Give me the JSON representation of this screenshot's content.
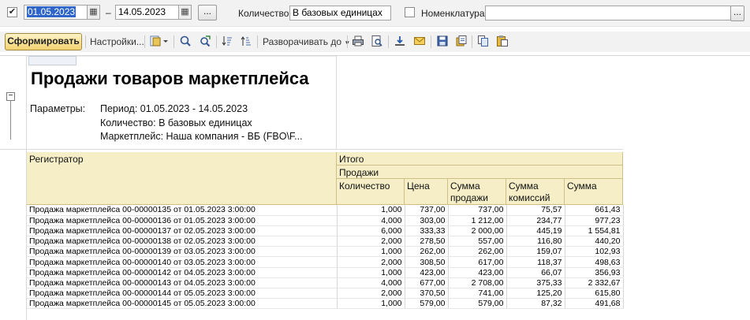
{
  "filter": {
    "period_checked": "✔",
    "date_from": "01.05.2023",
    "dash": "–",
    "date_to": "14.05.2023",
    "period_more": "...",
    "quantity_label": "Количество:",
    "quantity_value": "В базовых единицах",
    "nomenclature_label": "Номенклатура:",
    "nomenclature_value": "",
    "nomenclature_more": "..."
  },
  "toolbar": {
    "generate": "Сформировать",
    "settings": "Настройки...",
    "expand_to": "Разворачивать до"
  },
  "report": {
    "title": "Продажи товаров маркетплейса",
    "params_label": "Параметры:",
    "params": [
      "Период: 01.05.2023 - 14.05.2023",
      "Количество: В базовых единицах",
      "Маркетплейс: Наша компания - ВБ (FBO\\F..."
    ],
    "headers": {
      "registrar": "Регистратор",
      "total": "Итого",
      "sales": "Продажи",
      "quantity": "Количество",
      "price": "Цена",
      "sale_sum_1": "Сумма",
      "sale_sum_2": "продажи",
      "commission_1": "Сумма",
      "commission_2": "комиссий",
      "sum": "Сумма"
    },
    "rows": [
      {
        "doc": "Продажа маркетплейса 00-00000135 от 01.05.2023 3:00:00",
        "qty": "1,000",
        "price": "737,00",
        "sale": "737,00",
        "comm": "75,57",
        "sum": "661,43"
      },
      {
        "doc": "Продажа маркетплейса 00-00000136 от 01.05.2023 3:00:00",
        "qty": "4,000",
        "price": "303,00",
        "sale": "1 212,00",
        "comm": "234,77",
        "sum": "977,23"
      },
      {
        "doc": "Продажа маркетплейса 00-00000137 от 02.05.2023 3:00:00",
        "qty": "6,000",
        "price": "333,33",
        "sale": "2 000,00",
        "comm": "445,19",
        "sum": "1 554,81"
      },
      {
        "doc": "Продажа маркетплейса 00-00000138 от 02.05.2023 3:00:00",
        "qty": "2,000",
        "price": "278,50",
        "sale": "557,00",
        "comm": "116,80",
        "sum": "440,20"
      },
      {
        "doc": "Продажа маркетплейса 00-00000139 от 03.05.2023 3:00:00",
        "qty": "1,000",
        "price": "262,00",
        "sale": "262,00",
        "comm": "159,07",
        "sum": "102,93"
      },
      {
        "doc": "Продажа маркетплейса 00-00000140 от 03.05.2023 3:00:00",
        "qty": "2,000",
        "price": "308,50",
        "sale": "617,00",
        "comm": "118,37",
        "sum": "498,63"
      },
      {
        "doc": "Продажа маркетплейса 00-00000142 от 04.05.2023 3:00:00",
        "qty": "1,000",
        "price": "423,00",
        "sale": "423,00",
        "comm": "66,07",
        "sum": "356,93"
      },
      {
        "doc": "Продажа маркетплейса 00-00000143 от 04.05.2023 3:00:00",
        "qty": "4,000",
        "price": "677,00",
        "sale": "2 708,00",
        "comm": "375,33",
        "sum": "2 332,67"
      },
      {
        "doc": "Продажа маркетплейса 00-00000144 от 05.05.2023 3:00:00",
        "qty": "2,000",
        "price": "370,50",
        "sale": "741,00",
        "comm": "125,20",
        "sum": "615,80"
      },
      {
        "doc": "Продажа маркетплейса 00-00000145 от 05.05.2023 3:00:00",
        "qty": "1,000",
        "price": "579,00",
        "sale": "579,00",
        "comm": "87,32",
        "sum": "491,68"
      }
    ]
  },
  "colors": {
    "header_fill": "#f5eec6",
    "generate_button": "#f2d272",
    "date_selection": "#2f64c8"
  },
  "icons": [
    "checkbox-icon",
    "calendar-icon",
    "report-variant-icon",
    "search-icon",
    "find-next-icon",
    "sort-desc-icon",
    "sort-asc-icon",
    "print-icon",
    "print-preview-icon",
    "download-icon",
    "email-icon",
    "save-icon",
    "open-icon",
    "copy-icon",
    "paste-icon"
  ]
}
